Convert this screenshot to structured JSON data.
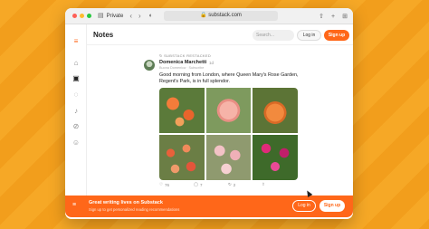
{
  "browser": {
    "private_label": "Private",
    "url": "substack.com"
  },
  "header": {
    "title": "Notes",
    "search_placeholder": "Search...",
    "login_label": "Log in",
    "signup_label": "Sign up"
  },
  "post": {
    "restack_label": "SUBSTACK RESTACKED",
    "author": "Domenica Marchetti",
    "time": "1d",
    "subtitle": "Buona Domenica · Subscribe",
    "text": "Good morning from London, where Queen Mary's Rose Garden, Regent's Park, is in full splendor.",
    "photos": [
      "orange-roses",
      "peach-rose",
      "orange-rose",
      "rose-beds",
      "pink-roses",
      "magenta-roses"
    ],
    "likes": "76",
    "comments": "7",
    "restacks": "2"
  },
  "banner": {
    "title": "Great writing lives on Substack",
    "subtitle": "Sign up to get personalized reading recommendations",
    "login_label": "Log in",
    "signup_label": "Sign up"
  },
  "colors": {
    "brand": "#ff6719",
    "background": "#f5a623"
  }
}
